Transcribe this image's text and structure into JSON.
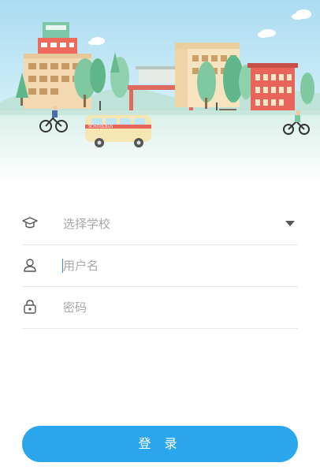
{
  "form": {
    "school_select": {
      "placeholder": "选择学校",
      "icon": "graduation-cap-icon"
    },
    "username": {
      "placeholder": "用户名",
      "icon": "user-icon"
    },
    "password": {
      "placeholder": "密码",
      "icon": "lock-icon"
    }
  },
  "login_button": {
    "label": "登 录"
  },
  "banner": {
    "bus_sign": "SCHOOLBUS",
    "colors": {
      "sky": "#b9e4f5",
      "ground": "#e3f2ee",
      "accent": "#2aa7ec"
    }
  }
}
